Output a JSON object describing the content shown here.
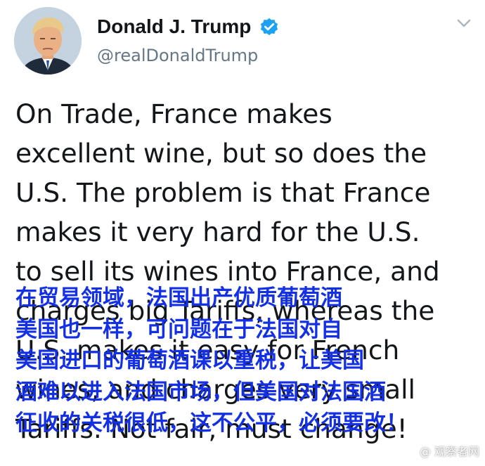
{
  "tweet": {
    "author": {
      "display_name": "Donald J. Trump",
      "handle": "@realDonaldTrump",
      "verified": true,
      "avatar_icon": "profile-photo",
      "verified_icon": "verified-badge-icon",
      "menu_icon": "chevron-down-icon"
    },
    "text_lines": [
      "On Trade, France makes",
      "excellent wine, but so does the",
      "U.S. The problem is that France",
      "makes it very hard for the U.S.",
      "to sell its wines into France, and",
      "charges big Tariffs, whereas the",
      "U.S. makes it easy for French",
      "wines, and charges very small",
      "Tariffs. Not fair, must change!"
    ]
  },
  "overlay": {
    "lines": [
      "在贸易领域，法国出产优质葡萄酒",
      "美国也一样，可问题在于法国对自",
      "美国进口的葡萄酒课以重税，让美国",
      "酒难以进入法国市场，但美国对法国酒",
      "征收的关税很低，这不公平，必须要改！"
    ],
    "color": "#1430e6"
  },
  "watermark": {
    "text": "@ 观察者网"
  },
  "colors": {
    "name": "#14171a",
    "handle": "#657786",
    "verified": "#1da1f2",
    "chevron": "#aab8c2"
  }
}
